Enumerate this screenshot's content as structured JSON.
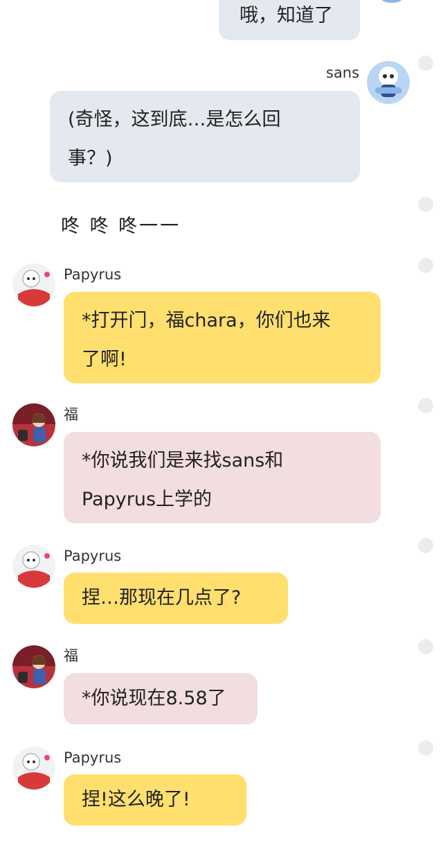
{
  "messages": [
    {
      "speaker": "",
      "text": "哦，知道了",
      "side": "right"
    },
    {
      "speaker": "sans",
      "line1": "(奇怪，这到底…是怎么回",
      "line2": "事？)",
      "side": "right"
    },
    {
      "narration": "咚 咚 咚一一"
    },
    {
      "speaker": "Papyrus",
      "line1": "*打开门，福chara，你们也来",
      "line2": "了啊!",
      "style": "yellow"
    },
    {
      "speaker": "福",
      "line1": "*你说我们是来找sans和",
      "line2": "Papyrus上学的",
      "style": "pink"
    },
    {
      "speaker": "Papyrus",
      "text": "捏…那现在几点了?",
      "style": "yellow"
    },
    {
      "speaker": "福",
      "text": "*你说现在8.58了",
      "style": "pink"
    },
    {
      "speaker": "Papyrus",
      "text": "捏!这么晚了!",
      "style": "yellow"
    }
  ],
  "avatars": {
    "sans": "sans-avatar",
    "papyrus": "papyrus-avatar",
    "fu": "fu-avatar"
  },
  "colors": {
    "self_bubble": "#e4e8ef",
    "papyrus_bubble": "#ffdf6e",
    "fu_bubble": "#f2dde0"
  }
}
